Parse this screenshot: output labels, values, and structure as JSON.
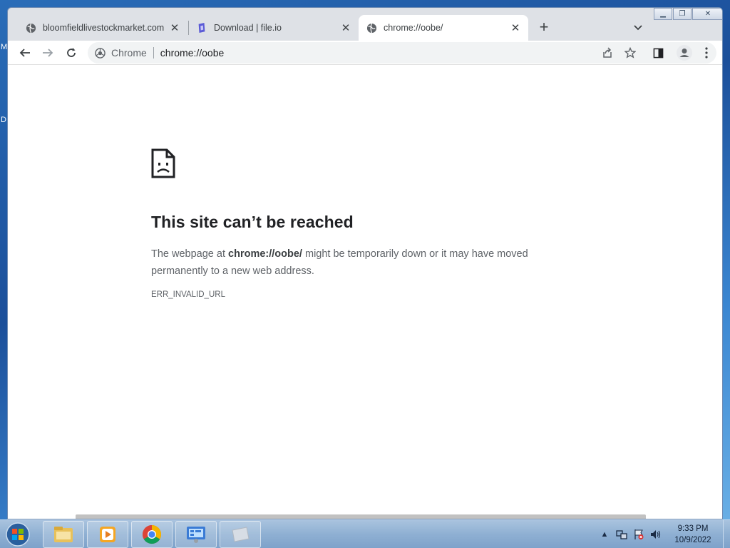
{
  "desktop": {
    "sliver_m": "M",
    "sliver_d": "D"
  },
  "tabs": [
    {
      "title": "bloomfieldlivestockmarket.com",
      "icon": "globe-icon",
      "active": false
    },
    {
      "title": "Download | file.io",
      "icon": "fileio-icon",
      "active": false
    },
    {
      "title": "chrome://oobe/",
      "icon": "globe-icon",
      "active": true
    }
  ],
  "omnibox": {
    "site_label": "Chrome",
    "url": "chrome://oobe"
  },
  "error": {
    "title": "This site can’t be reached",
    "body_prefix": "The webpage at ",
    "body_url": "chrome://oobe/",
    "body_suffix": " might be temporarily down or it may have moved permanently to a new web address.",
    "code": "ERR_INVALID_URL"
  },
  "taskbar": {
    "items": [
      "explorer-icon",
      "media-player-icon",
      "chrome-icon",
      "control-panel-icon",
      "blank-app-icon"
    ]
  },
  "clock": {
    "time": "9:33 PM",
    "date": "10/9/2022"
  },
  "colors": {
    "accent": "#1a73e8",
    "tab_bg": "#dee1e6",
    "text": "#202124"
  }
}
